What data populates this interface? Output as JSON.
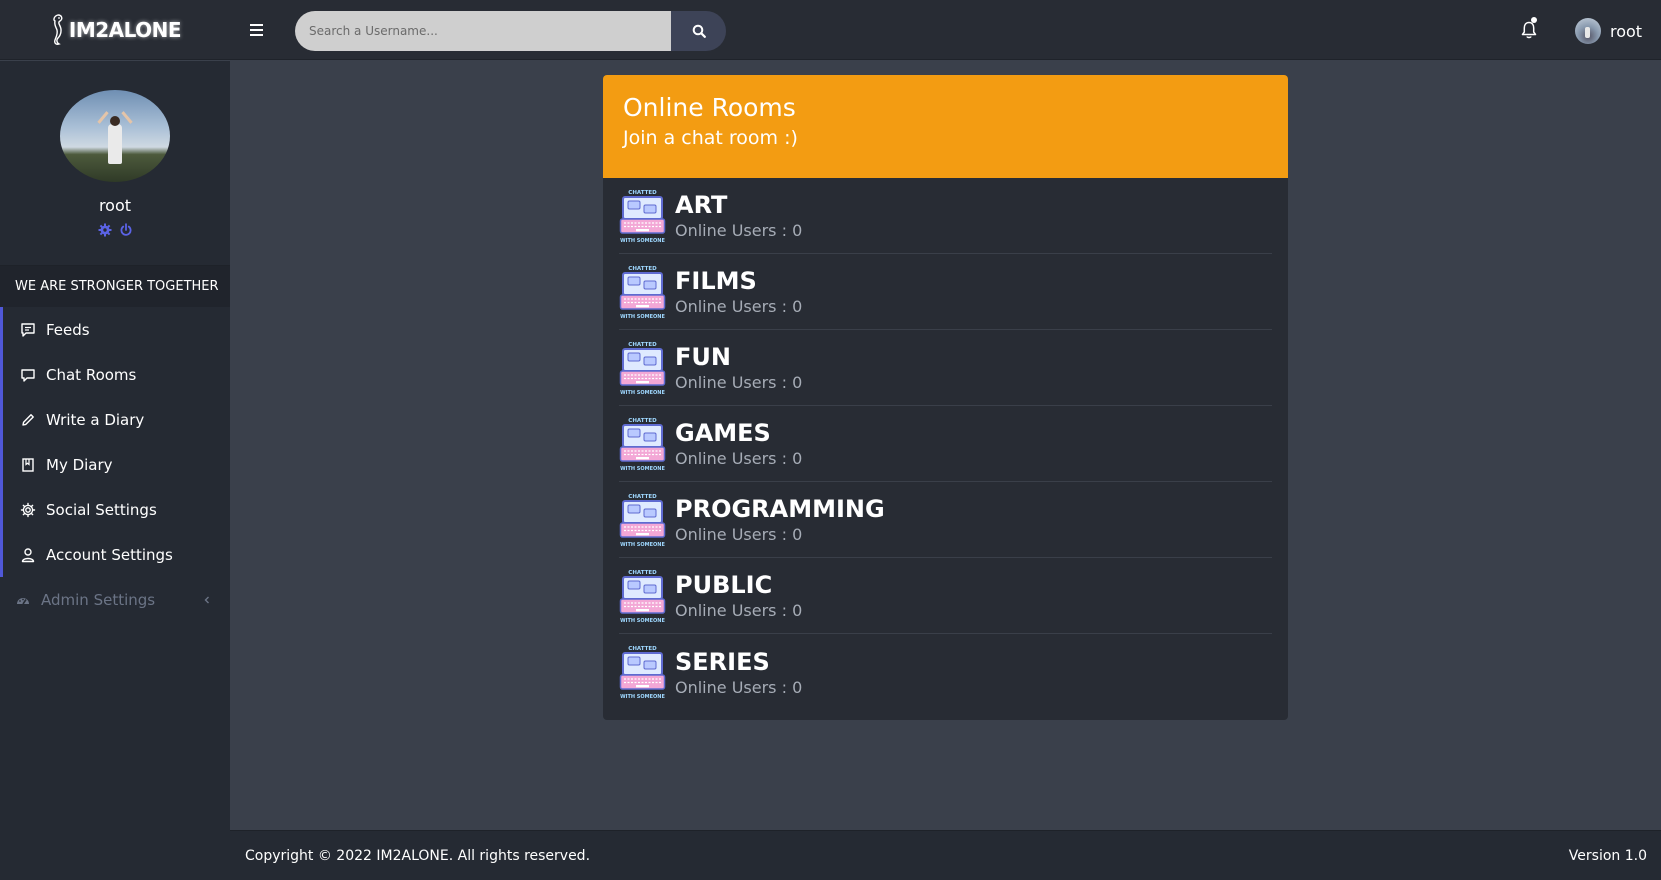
{
  "brand": {
    "name": "IM2ALONE"
  },
  "search": {
    "placeholder": "Search a Username..."
  },
  "user": {
    "name": "root"
  },
  "sidebar": {
    "profile_name": "root",
    "motto": "WE ARE STRONGER TOGETHER",
    "items": [
      {
        "label": "Feeds",
        "icon": "feeds-icon"
      },
      {
        "label": "Chat Rooms",
        "icon": "chat-icon"
      },
      {
        "label": "Write a Diary",
        "icon": "pencil-icon"
      },
      {
        "label": "My Diary",
        "icon": "book-icon"
      },
      {
        "label": "Social Settings",
        "icon": "gear-icon"
      },
      {
        "label": "Account Settings",
        "icon": "user-icon"
      }
    ],
    "admin": {
      "label": "Admin Settings",
      "icon": "dashboard-icon"
    }
  },
  "rooms": {
    "title": "Online Rooms",
    "subtitle": "Join a chat room :)",
    "list": [
      {
        "name": "ART",
        "users": "Online Users : 0"
      },
      {
        "name": "FILMS",
        "users": "Online Users : 0"
      },
      {
        "name": "FUN",
        "users": "Online Users : 0"
      },
      {
        "name": "GAMES",
        "users": "Online Users : 0"
      },
      {
        "name": "PROGRAMMING",
        "users": "Online Users : 0"
      },
      {
        "name": "PUBLIC",
        "users": "Online Users : 0"
      },
      {
        "name": "SERIES",
        "users": "Online Users : 0"
      }
    ]
  },
  "footer": {
    "copyright": "Copyright © 2022 IM2ALONE. All rights reserved.",
    "version": "Version 1.0"
  },
  "colors": {
    "accent": "#f39c12",
    "nav_border": "#5058d8",
    "background": "#3a404b",
    "panel": "#282c34"
  }
}
